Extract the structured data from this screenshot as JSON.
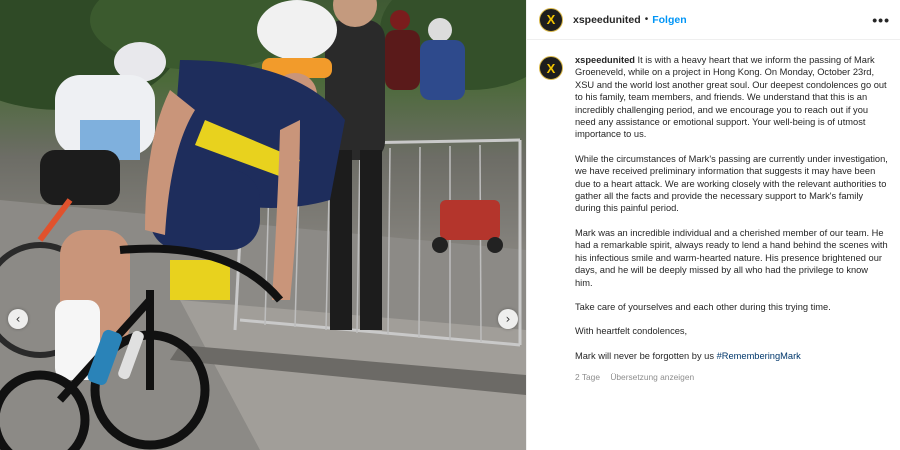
{
  "post": {
    "username": "xspeedunited",
    "follow_label": "Folgen",
    "separator": "•",
    "more_label": "•••",
    "avatar_letter": "X",
    "caption": {
      "p1": "It is with a heavy heart that we inform the passing of Mark Groeneveld, while on a project in Hong Kong.  On Monday, October 23rd, XSU and the world lost another great soul. Our deepest condolences go out to his family, team members, and friends. We understand that this is an incredibly challenging period, and we encourage you to reach out if you need any assistance or emotional support. Your well-being is of utmost importance to us.",
      "p2": "While the circumstances of Mark's passing are currently under investigation, we have received preliminary information that suggests it may have been due to a heart attack. We are working closely with the relevant authorities to gather all the facts and provide the necessary support to Mark's family during this painful period.",
      "p3": "Mark was an incredible individual and a cherished member of our team. He had a remarkable spirit, always ready to lend a hand behind the scenes with his infectious smile and warm-hearted nature. His presence brightened our days, and he will be deeply missed by all who had the privilege to know him.",
      "p4": "Take care of yourselves and each other during this trying time.",
      "p5": "With heartfelt condolences,",
      "p6_text": "Mark will never be forgotten by us",
      "hashtag": "#RememberingMark"
    },
    "time_ago": "2 Tage",
    "translate_label": "Übersetzung anzeigen"
  },
  "photo": {
    "prev_icon": "‹",
    "next_icon": "›"
  }
}
